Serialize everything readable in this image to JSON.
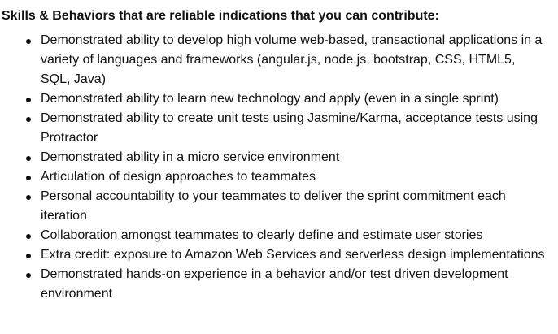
{
  "section": {
    "heading": "Skills & Behaviors that are reliable indications that you can contribute:",
    "items": [
      "Demonstrated ability to develop high volume web-based, transactional applications in a variety of languages and frameworks (angular.js, node.js, bootstrap, CSS, HTML5, SQL, Java)",
      "Demonstrated ability to learn new technology and apply (even in a single sprint)",
      "Demonstrated ability to create unit tests using Jasmine/Karma, acceptance tests using Protractor",
      "Demonstrated ability in a micro service environment",
      "Articulation of design approaches to teammates",
      "Personal accountability to your teammates to deliver the sprint commitment each iteration",
      "Collaboration amongst teammates to clearly define and estimate user stories",
      "Extra credit: exposure to Amazon Web Services and serverless design implementations",
      "Demonstrated hands-on experience in a behavior and/or test driven development environment"
    ]
  }
}
